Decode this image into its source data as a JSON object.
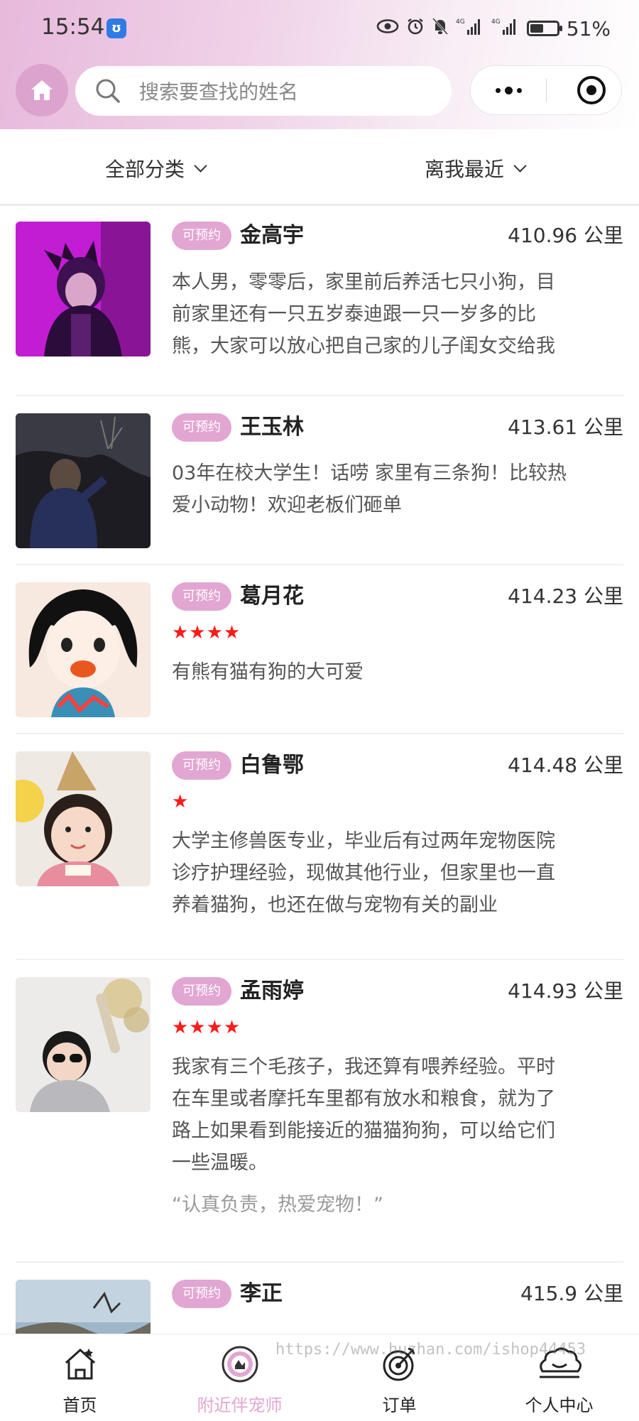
{
  "status_bar": {
    "time": "15:54",
    "battery_percent": "51%",
    "battery_level": 0.51,
    "network_1": "4G",
    "network_2": "4G"
  },
  "header": {
    "search_placeholder": "搜索要查找的姓名",
    "accent_color": "#e2a6d2"
  },
  "filters": {
    "category_label": "全部分类",
    "sort_label": "离我最近"
  },
  "sitters": [
    {
      "badge": "可预约",
      "name": "金高宇",
      "distance": "410.96 公里",
      "rating": 0,
      "desc_lines": [
        "本人男，零零后，家里前后养活七只小狗，目",
        "前家里还有一只五岁泰迪跟一只一岁多的比",
        "熊，大家可以放心把自己家的儿子闺女交给我"
      ],
      "quote": ""
    },
    {
      "badge": "可预约",
      "name": "王玉林",
      "distance": "413.61 公里",
      "rating": 0,
      "desc_lines": [
        "03年在校大学生！话唠 家里有三条狗！比较热",
        "爱小动物！欢迎老板们砸单"
      ],
      "quote": ""
    },
    {
      "badge": "可预约",
      "name": "葛月花",
      "distance": "414.23 公里",
      "rating": 4,
      "stars": "★★★★",
      "desc_lines": [
        "有熊有猫有狗的大可爱"
      ],
      "quote": ""
    },
    {
      "badge": "可预约",
      "name": "白鲁鄂",
      "distance": "414.48 公里",
      "rating": 1,
      "stars": "★",
      "desc_lines": [
        "大学主修兽医专业，毕业后有过两年宠物医院",
        "诊疗护理经验，现做其他行业，但家里也一直",
        "养着猫狗，也还在做与宠物有关的副业"
      ],
      "quote": ""
    },
    {
      "badge": "可预约",
      "name": "孟雨婷",
      "distance": "414.93 公里",
      "rating": 4,
      "stars": "★★★★",
      "desc_lines": [
        "我家有三个毛孩子，我还算有喂养经验。平时",
        "在车里或者摩托车里都有放水和粮食，就为了",
        "路上如果看到能接近的猫猫狗狗，可以给它们",
        "一些温暖。"
      ],
      "quote": "“认真负责，热爱宠物！”"
    },
    {
      "badge": "可预约",
      "name": "李正",
      "distance": "415.9 公里",
      "rating": 0,
      "desc_lines": [],
      "quote": ""
    }
  ],
  "tabbar": {
    "tabs": [
      {
        "label": "首页",
        "icon": "house-icon",
        "active": false
      },
      {
        "label": "附近伴宠师",
        "icon": "nearby-icon",
        "active": true
      },
      {
        "label": "订单",
        "icon": "target-icon",
        "active": false
      },
      {
        "label": "个人中心",
        "icon": "profile-icon",
        "active": false
      }
    ]
  },
  "watermark": "https://www.huzhan.com/ishop44453"
}
